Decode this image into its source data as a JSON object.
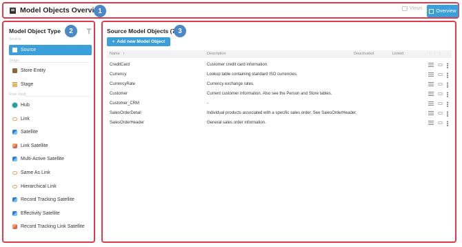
{
  "header": {
    "title": "Model Objects Overview",
    "views_label": "Views",
    "overview_label": "Overview",
    "badge": "1"
  },
  "left_panel": {
    "title": "Model Object Type",
    "badge": "2",
    "sections": {
      "source": "Source",
      "stage": "Stage",
      "raw_vault": "Raw Vault"
    },
    "items": [
      {
        "label": "Source",
        "icon": "source-icon"
      },
      {
        "label": "Store Entity",
        "icon": "store-entity-icon"
      },
      {
        "label": "Stage",
        "icon": "stage-icon"
      },
      {
        "label": "Hub",
        "icon": "hub-icon"
      },
      {
        "label": "Link",
        "icon": "link-icon"
      },
      {
        "label": "Satellite",
        "icon": "satellite-icon"
      },
      {
        "label": "Link Satellite",
        "icon": "link-satellite-icon"
      },
      {
        "label": "Multi-Active Satellite",
        "icon": "satellite-icon"
      },
      {
        "label": "Same As Link",
        "icon": "link-icon"
      },
      {
        "label": "Hierarchical Link",
        "icon": "link-icon"
      },
      {
        "label": "Record Tracking Satellite",
        "icon": "satellite-icon"
      },
      {
        "label": "Effectivity Satellite",
        "icon": "satellite-icon"
      },
      {
        "label": "Record Tracking Link Satellite",
        "icon": "link-satellite-icon"
      }
    ]
  },
  "main": {
    "title": "Source Model Objects (7)",
    "badge": "3",
    "add_button": "Add new  Model Object",
    "columns": {
      "name": "Name",
      "sort": "↑",
      "description": "Description",
      "deactivated": "Deactivated",
      "linked": "Linked"
    },
    "rows": [
      {
        "name": "CreditCard",
        "description": "Customer credit card information."
      },
      {
        "name": "Currency",
        "description": "Lookup table containing standard ISO currencies."
      },
      {
        "name": "CurrencyRate",
        "description": "Currency exchange rates."
      },
      {
        "name": "Customer",
        "description": "Current customer information. Also see the Person and Store tables."
      },
      {
        "name": "Customer_CRM",
        "description": "-"
      },
      {
        "name": "SalesOrderDetail",
        "description": "Individual products associated with a specific sales order. See SalesOrderHeader."
      },
      {
        "name": "SalesOrderHeader",
        "description": "General sales order information."
      }
    ]
  },
  "colors": {
    "accent": "#3b9fd9",
    "highlight": "#e0394a",
    "badge": "#4a88c8"
  }
}
